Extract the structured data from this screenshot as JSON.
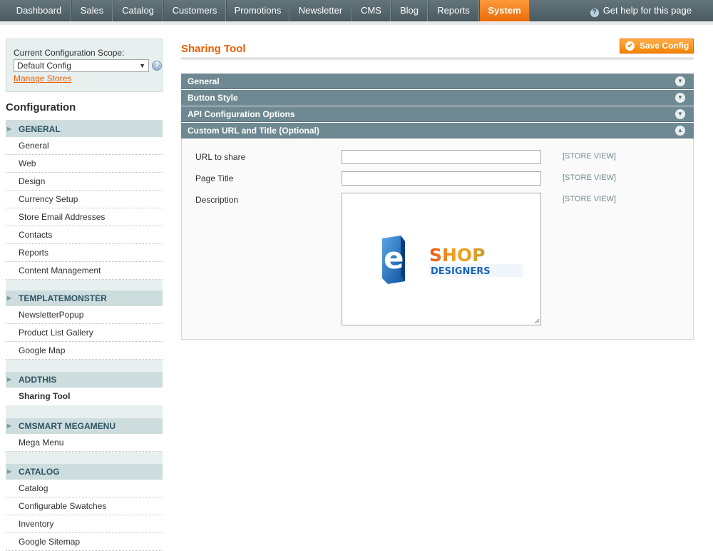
{
  "nav": {
    "items": [
      "Dashboard",
      "Sales",
      "Catalog",
      "Customers",
      "Promotions",
      "Newsletter",
      "CMS",
      "Blog",
      "Reports",
      "System"
    ],
    "active": "System",
    "help": "Get help for this page"
  },
  "scope": {
    "label": "Current Configuration Scope:",
    "selected": "Default Config",
    "manage_stores": "Manage Stores"
  },
  "sidebar": {
    "title": "Configuration",
    "sections": [
      {
        "title": "GENERAL",
        "items": [
          "General",
          "Web",
          "Design",
          "Currency Setup",
          "Store Email Addresses",
          "Contacts",
          "Reports",
          "Content Management"
        ]
      },
      {
        "title": "TEMPLATEMONSTER",
        "items": [
          "NewsletterPopup",
          "Product List Gallery",
          "Google Map"
        ]
      },
      {
        "title": "ADDTHIS",
        "items": [
          "Sharing Tool"
        ]
      },
      {
        "title": "CMSMART MEGAMENU",
        "items": [
          "Mega Menu"
        ]
      },
      {
        "title": "CATALOG",
        "items": [
          "Catalog",
          "Configurable Swatches",
          "Inventory",
          "Google Sitemap"
        ]
      }
    ],
    "active_item": "Sharing Tool"
  },
  "main": {
    "title": "Sharing Tool",
    "save_label": "Save Config",
    "fieldsets": [
      {
        "label": "General",
        "open": false
      },
      {
        "label": "Button Style",
        "open": false
      },
      {
        "label": "API Configuration Options",
        "open": false
      },
      {
        "label": "Custom URL and Title (Optional)",
        "open": true
      }
    ],
    "fields": [
      {
        "label": "URL to share",
        "value": "",
        "scope": "[STORE VIEW]"
      },
      {
        "label": "Page Title",
        "value": "",
        "scope": "[STORE VIEW]"
      },
      {
        "label": "Description",
        "value": "",
        "scope": "[STORE VIEW]"
      }
    ],
    "logo": {
      "letter": "e",
      "line1": "SHOP",
      "line2": "DESIGNERS"
    }
  },
  "colors": {
    "accent": "#eb5e00",
    "nav_bg": "#56676e",
    "fieldset_header": "#6f8992",
    "sidebar_bg": "#e7efef",
    "sidebar_header": "#cddddd"
  },
  "icons": {
    "help": "help-circle-icon",
    "save": "checkmark-icon",
    "collapsed": "chevron-down-icon",
    "expanded": "chevron-up-icon"
  }
}
